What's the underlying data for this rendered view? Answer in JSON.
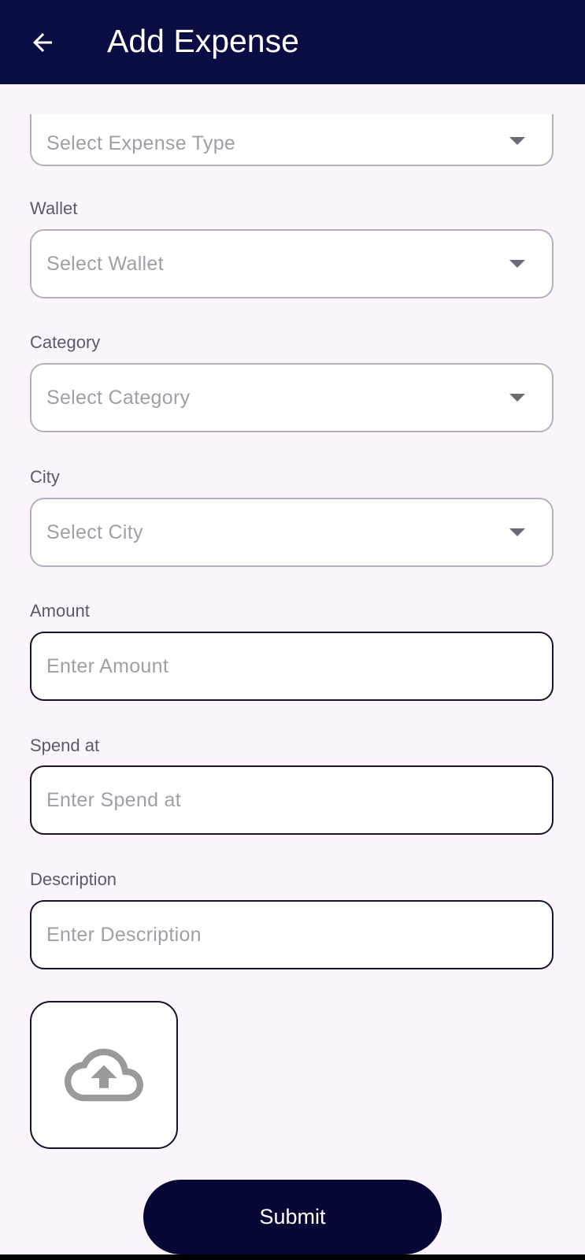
{
  "appbar": {
    "title": "Add Expense",
    "back_icon": "arrow-left-icon"
  },
  "form": {
    "expense_type": {
      "placeholder": "Select Expense Type"
    },
    "wallet": {
      "label": "Wallet",
      "placeholder": "Select Wallet"
    },
    "category": {
      "label": "Category",
      "placeholder": "Select Category"
    },
    "city": {
      "label": "City",
      "placeholder": "Select City"
    },
    "amount": {
      "label": "Amount",
      "placeholder": "Enter Amount",
      "value": ""
    },
    "spend_at": {
      "label": "Spend at",
      "placeholder": "Enter Spend at",
      "value": ""
    },
    "description": {
      "label": "Description",
      "placeholder": "Enter Description",
      "value": ""
    }
  },
  "upload": {
    "icon": "cloud-upload-icon"
  },
  "submit": {
    "label": "Submit"
  },
  "colors": {
    "appbar": "#0a0c44",
    "background": "#fcf5fd",
    "submit": "#060734",
    "select_border": "#b3b1ba",
    "input_border": "#141229"
  }
}
